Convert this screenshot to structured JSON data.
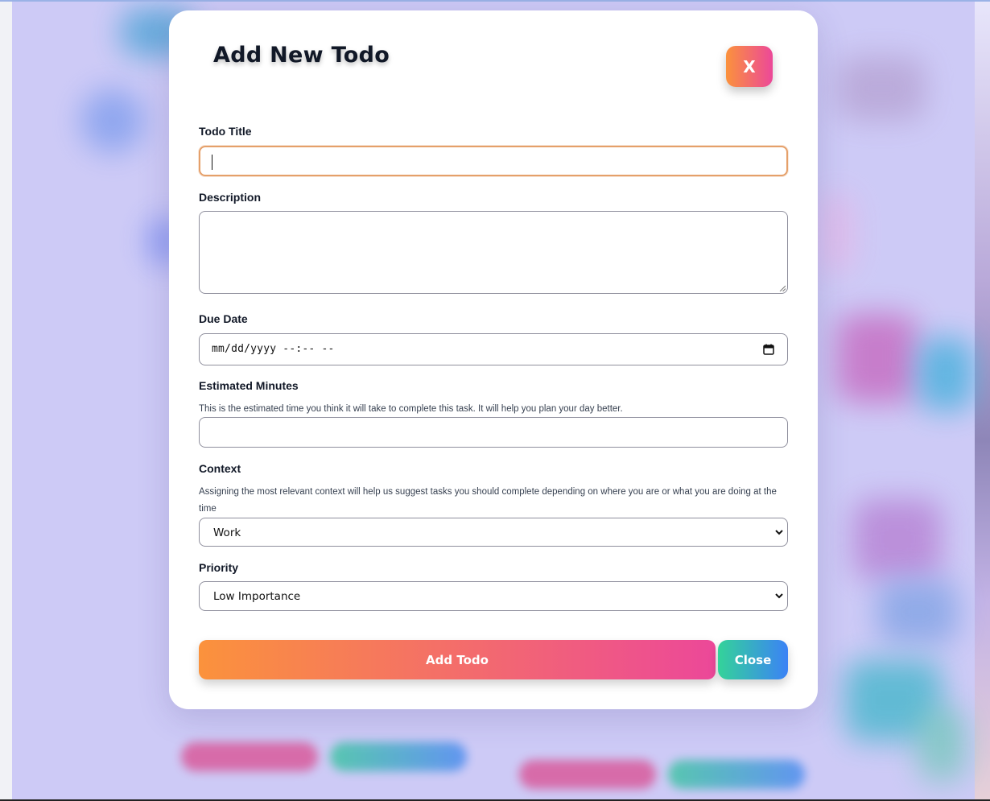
{
  "modal": {
    "title": "Add New Todo",
    "close_x_label": "X"
  },
  "form": {
    "title": {
      "label": "Todo Title",
      "value": ""
    },
    "description": {
      "label": "Description",
      "value": ""
    },
    "due_date": {
      "label": "Due Date",
      "value": "mm/dd/yyyy --:-- --"
    },
    "estimated_minutes": {
      "label": "Estimated Minutes",
      "hint": "This is the estimated time you think it will take to complete this task. It will help you plan your day better.",
      "value": ""
    },
    "context": {
      "label": "Context",
      "hint": "Assigning the most relevant context will help us suggest tasks you should complete depending on where you are or what you are doing at the time",
      "selected": "Work"
    },
    "priority": {
      "label": "Priority",
      "selected": "Low Importance"
    }
  },
  "actions": {
    "add_label": "Add Todo",
    "close_label": "Close"
  },
  "colors": {
    "accent_gradient_start": "#fb923c",
    "accent_gradient_end": "#ec4899",
    "secondary_gradient_start": "#34d399",
    "secondary_gradient_end": "#3b82f6",
    "focus_border": "#e5a06a",
    "backdrop": "#cdcaf6"
  },
  "icons": {
    "date": "calendar-icon",
    "select": "chevron-down-icon"
  }
}
